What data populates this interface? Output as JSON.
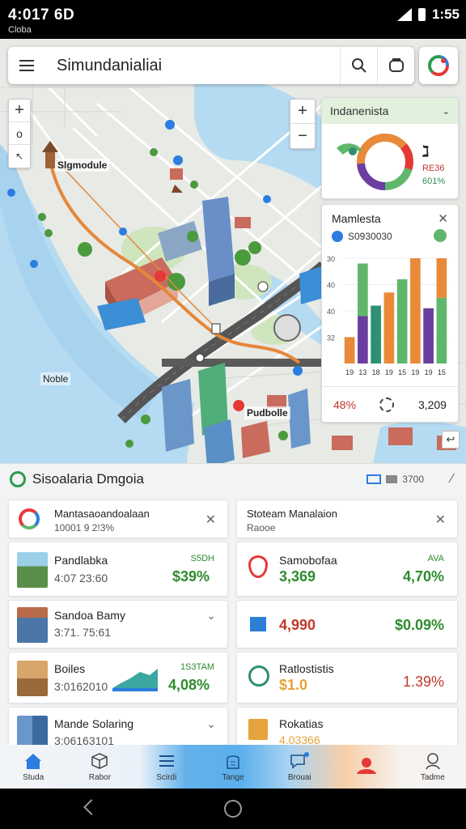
{
  "status": {
    "time": "4:017 6D",
    "sub": "Cloba",
    "right_time": "1:55"
  },
  "search": {
    "title": "Simundanialiai"
  },
  "map": {
    "labels": [
      "Slgmodule",
      "Noble",
      "Pudbolle"
    ],
    "route_color": "#e5873a"
  },
  "widget_indo": {
    "title": "Indanenista",
    "stat1": "ℷ",
    "stat2": "RE36",
    "stat3": "601%"
  },
  "widget_chart": {
    "title": "Mamlesta",
    "subtitle": "S0930030",
    "footer_left": "48%",
    "footer_right": "3,209"
  },
  "chart_data": {
    "type": "bar",
    "categories": [
      "19",
      "13",
      "18",
      "19",
      "15",
      "19",
      "19",
      "15"
    ],
    "ylim": [
      0,
      40
    ],
    "yticks": [
      "30",
      "40",
      "40",
      "32"
    ],
    "series": [
      {
        "values": [
          10,
          0,
          0,
          27,
          0,
          0,
          0,
          0
        ],
        "color": "#e98a3a"
      },
      {
        "values": [
          0,
          18,
          0,
          0,
          0,
          0,
          21,
          0
        ],
        "color": "#6a3fa0"
      },
      {
        "values": [
          0,
          0,
          22,
          0,
          0,
          0,
          0,
          0
        ],
        "color": "#2f8f72"
      },
      {
        "values": [
          0,
          20,
          0,
          0,
          32,
          0,
          0,
          25
        ],
        "color": "#5fb76b"
      },
      {
        "values": [
          0,
          0,
          0,
          0,
          0,
          42,
          0,
          15
        ],
        "color": "#e98a3a"
      }
    ]
  },
  "sheet": {
    "title": "Sisoalaria Dmgoia",
    "meta": "3700",
    "left_header": {
      "title": "Mantasaoandoalaan",
      "sub": "10001 9 2!3%"
    },
    "right_header": {
      "title": "Stoteam Manalaion",
      "sub": "Raooe"
    },
    "left_items": [
      {
        "name": "Pandlabka",
        "value": "4:07 23:60",
        "tag": "S5DH",
        "pct": "$39%"
      },
      {
        "name": "Sandoa Bamy",
        "value": "3:71. 75:61",
        "tag": "",
        "pct": ""
      },
      {
        "name": "Boiles",
        "value": "3:0162010",
        "tag": "1S3TAM",
        "pct": "4,08%"
      },
      {
        "name": "Mande Solaring",
        "value": "3:06163101",
        "tag": "",
        "pct": ""
      }
    ],
    "right_items": [
      {
        "name": "Samobofaa",
        "value": "3,369",
        "tag": "AVA",
        "pct": "4,70%"
      },
      {
        "name": "",
        "value": "4,990",
        "tag": "",
        "pct": "$0.09%"
      },
      {
        "name": "Ratlostistis",
        "value": "$1.0",
        "tag": "",
        "pct": "1.39%"
      },
      {
        "name": "Rokatias",
        "value": "4.03366",
        "tag": "",
        "pct": ""
      }
    ]
  },
  "nav": {
    "items": [
      {
        "label": "Studa",
        "icon": "home-icon"
      },
      {
        "label": "Rabor",
        "icon": "cube-icon"
      },
      {
        "label": "Scirdi",
        "icon": "list-icon"
      },
      {
        "label": "Tange",
        "icon": "building-icon"
      },
      {
        "label": "Brouai",
        "icon": "chat-icon"
      },
      {
        "label": "",
        "icon": "person-icon"
      },
      {
        "label": "Tadme",
        "icon": "profile-icon"
      }
    ]
  }
}
